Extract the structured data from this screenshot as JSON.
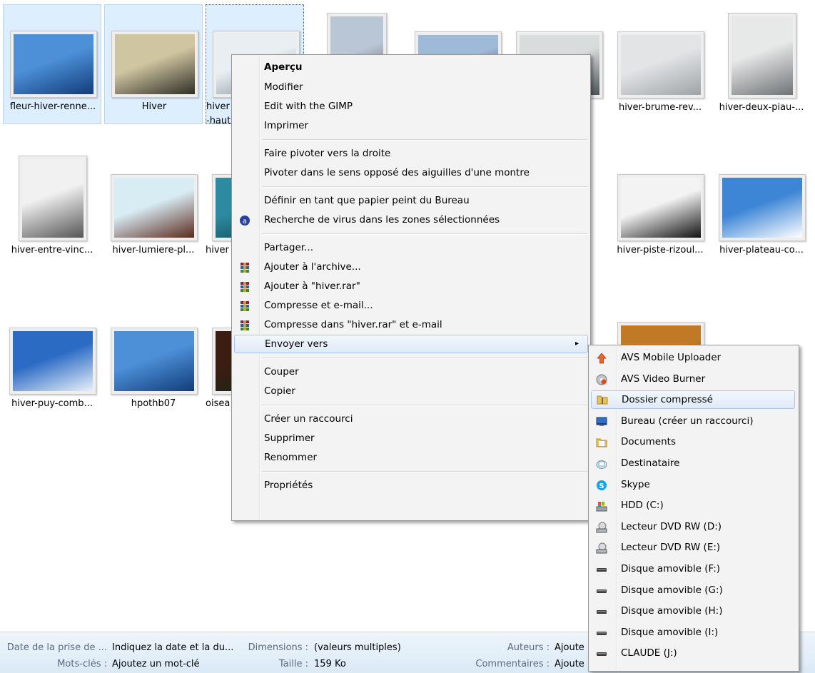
{
  "files": [
    {
      "name": "fleur-hiver-renne...",
      "state": "selected",
      "colors": [
        "#4d90d8",
        "#123c7a"
      ]
    },
    {
      "name": "Hiver",
      "state": "selected",
      "colors": [
        "#cfc5a0",
        "#2f2f28"
      ]
    },
    {
      "name": "hiver-...-haut...",
      "line1": "hiver",
      "line2": "-haut",
      "state": "focus",
      "colors": [
        "#e9eef3",
        "#7d8a95"
      ]
    },
    {
      "name": "",
      "state": "",
      "colors": [
        "#b8c6d6",
        "#5a4f46"
      ]
    },
    {
      "name": "",
      "state": "",
      "colors": [
        "#9fb9d8",
        "#1a2430"
      ]
    },
    {
      "name": "",
      "state": "",
      "colors": [
        "#d9dcdc",
        "#4b5458"
      ]
    },
    {
      "name": "hiver-brume-rev...",
      "state": "",
      "colors": [
        "#e2e4e6",
        "#9da3a7"
      ]
    },
    {
      "name": "hiver-deux-piau-...",
      "state": "",
      "colors": [
        "#e7e8e8",
        "#6f7375"
      ]
    },
    {
      "name": "hiver-entre-vinc...",
      "state": "",
      "colors": [
        "#f1f1f1",
        "#555"
      ]
    },
    {
      "name": "hiver-lumiere-pl...",
      "state": "",
      "colors": [
        "#d8ecf4",
        "#5c2a1d"
      ]
    },
    {
      "name": "hiver",
      "state": "",
      "colors": [
        "#2e8aa0",
        "#0f3d48"
      ]
    },
    {
      "name": "hiver-piste-rizoul...",
      "state": "",
      "colors": [
        "#f3f3f3",
        "#111"
      ]
    },
    {
      "name": "hiver-plateau-co...",
      "state": "",
      "colors": [
        "#3d86d6",
        "#ffffff"
      ]
    },
    {
      "name": "hiver-puy-comb...",
      "state": "",
      "colors": [
        "#2c6bc4",
        "#e8f0fa"
      ]
    },
    {
      "name": "hpothb07",
      "state": "",
      "colors": [
        "#4d90d8",
        "#123c7a"
      ]
    },
    {
      "name": "oisea",
      "state": "",
      "colors": [
        "#3b1d12",
        "#0b2a1a"
      ]
    },
    {
      "name": "",
      "state": "",
      "colors": [
        "#c07a25",
        "#5a3010"
      ]
    }
  ],
  "details": {
    "date_label": "Date de la prise de ...",
    "date_value": "Indiquez la date et la du...",
    "dimensions_label": "Dimensions :",
    "dimensions_value": "(valeurs multiples)",
    "authors_label": "Auteurs :",
    "authors_value": "Ajoute",
    "keywords_label": "Mots-clés :",
    "keywords_value": "Ajoutez un mot-clé",
    "size_label": "Taille :",
    "size_value": "159 Ko",
    "comments_label": "Commentaires :",
    "comments_value": "Ajoute"
  },
  "context_menu": {
    "items": [
      {
        "label": "Aperçu",
        "bold": true
      },
      {
        "label": "Modifier"
      },
      {
        "label": "Edit with the GIMP"
      },
      {
        "label": "Imprimer"
      },
      {
        "sep": true
      },
      {
        "label": "Faire pivoter vers la droite"
      },
      {
        "label": "Pivoter dans le sens opposé des aiguilles d'une montre"
      },
      {
        "sep": true
      },
      {
        "label": "Définir en tant que papier peint du Bureau"
      },
      {
        "label": "Recherche de virus dans les zones sélectionnées",
        "icon": "antivirus-icon"
      },
      {
        "sep": true
      },
      {
        "label": "Partager..."
      },
      {
        "label": "Ajouter à l'archive...",
        "icon": "winrar-icon"
      },
      {
        "label": "Ajouter à \"hiver.rar\"",
        "icon": "winrar-icon"
      },
      {
        "label": "Compresse et e-mail...",
        "icon": "winrar-icon"
      },
      {
        "label": "Compresse dans \"hiver.rar\" et e-mail",
        "icon": "winrar-icon"
      },
      {
        "label": "Envoyer vers",
        "submenu": true,
        "highlight": true
      },
      {
        "sep": true
      },
      {
        "label": "Couper"
      },
      {
        "label": "Copier"
      },
      {
        "sep": true
      },
      {
        "label": "Créer un raccourci"
      },
      {
        "label": "Supprimer"
      },
      {
        "label": "Renommer"
      },
      {
        "sep": true
      },
      {
        "label": "Propriétés"
      }
    ],
    "submenu_arrow": "▸"
  },
  "send_to_menu": {
    "items": [
      {
        "label": "AVS Mobile Uploader",
        "icon": "upload-arrow-icon"
      },
      {
        "label": "AVS Video Burner",
        "icon": "disc-burner-icon"
      },
      {
        "label": "Dossier compressé",
        "icon": "zip-folder-icon",
        "highlight": true
      },
      {
        "label": "Bureau (créer un raccourci)",
        "icon": "desktop-icon"
      },
      {
        "label": "Documents",
        "icon": "documents-folder-icon"
      },
      {
        "label": "Destinataire",
        "icon": "mail-recipient-icon"
      },
      {
        "label": "Skype",
        "icon": "skype-icon"
      },
      {
        "label": "HDD (C:)",
        "icon": "hard-drive-icon"
      },
      {
        "label": "Lecteur DVD RW (D:)",
        "icon": "dvd-drive-icon"
      },
      {
        "label": "Lecteur DVD RW (E:)",
        "icon": "dvd-drive-icon"
      },
      {
        "label": "Disque amovible (F:)",
        "icon": "removable-disk-icon"
      },
      {
        "label": "Disque amovible (G:)",
        "icon": "removable-disk-icon"
      },
      {
        "label": "Disque amovible (H:)",
        "icon": "removable-disk-icon"
      },
      {
        "label": "Disque amovible (I:)",
        "icon": "removable-disk-icon"
      },
      {
        "label": "CLAUDE (J:)",
        "icon": "removable-disk-icon"
      }
    ]
  }
}
